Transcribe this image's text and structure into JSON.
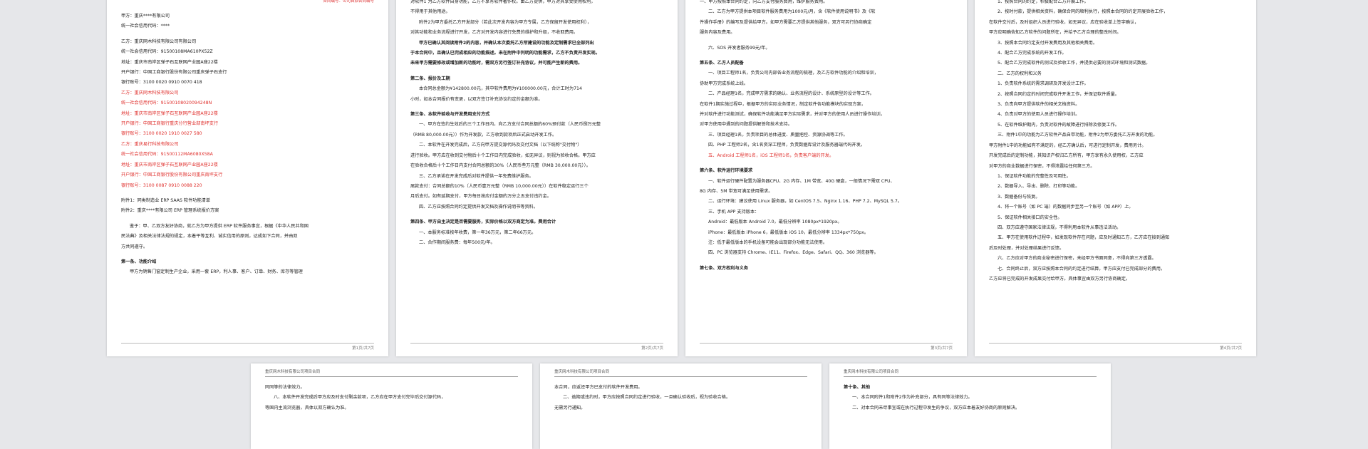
{
  "page1": {
    "top_right": "合同编号：公司自拟合同编号",
    "lines": [
      {
        "t": "甲方：重庆****有限公司",
        "c": ""
      },
      {
        "t": "统一社会信用代码：****",
        "c": ""
      },
      {
        "t": "",
        "c": "gap"
      },
      {
        "t": "乙方：重庆网木科技有限公司有限公司",
        "c": ""
      },
      {
        "t": "统一社会信用代码：91500108MA610PX52Z",
        "c": ""
      },
      {
        "t": "地址：重庆市南岸区弹子石互联网产业园A座22楼",
        "c": ""
      },
      {
        "t": "开户银行：中国工商银行股份有限公司重庆弹子石支行",
        "c": ""
      },
      {
        "t": "银行账号：3100 0020 0910 0070 418",
        "c": ""
      },
      {
        "t": "乙方：重庆网木科技有限公司",
        "c": "red"
      },
      {
        "t": "统一社会信用代码：91500108020094248N",
        "c": "red"
      },
      {
        "t": "地址：重庆市南岸区弹子石互联网产业园A座22楼",
        "c": "red"
      },
      {
        "t": "开户银行：中国工商银行重庆分行营业部南坪支行",
        "c": "red"
      },
      {
        "t": "银行账号：3100 0020 1910 0027 580",
        "c": "red"
      },
      {
        "t": "乙方：重庆易行科技有限公司",
        "c": "red"
      },
      {
        "t": "统一社会信用代码：91500112MA6080X58A",
        "c": "red"
      },
      {
        "t": "地址：重庆市南岸区弹子石互联网产业园A座22楼",
        "c": "red"
      },
      {
        "t": "开户银行：中国工商银行股份有限公司重庆南坪支行",
        "c": "red"
      },
      {
        "t": "银行账号：3100 0087 0910 0088 220",
        "c": "red"
      },
      {
        "t": "",
        "c": "gap"
      },
      {
        "t": "附件1：同类制造业 ERP SAAS 软件功能清单",
        "c": ""
      },
      {
        "t": "附件2：重庆****有限公司 ERP 管理系统报价方案",
        "c": ""
      },
      {
        "t": "",
        "c": "gap"
      },
      {
        "t": "鉴于：甲、乙双方友好协商，就乙方为甲方提供 ERP 软件服务事宜，根据《中华人民共和国",
        "c": "in"
      },
      {
        "t": "民法典》及相关法律法规的规定，本着平等互利、诚实信用的原则，达成如下合同，并由双",
        "c": ""
      },
      {
        "t": "方共同遵守。",
        "c": ""
      },
      {
        "t": "",
        "c": "gap"
      },
      {
        "t": "第一条、功能介绍",
        "c": "b"
      },
      {
        "t": "甲方为销售门窗定制生产企业，采用一套 ERP，利人事、客户、订单、财务、库存等管理",
        "c": "in"
      }
    ],
    "footer": "第1页/共7页"
  },
  "page2": {
    "lines": [
      {
        "t": "对软件1 为乙方软件自身功能，乙方不享有软件著作权。由乙方提供，甲方对其享受使用权利，",
        "c": ""
      },
      {
        "t": "不得用于其他用途。",
        "c": ""
      },
      {
        "t": "附件2为甲方委托乙方开发部分（若此次开发内容为甲方专属，乙方保留开发使用权利），",
        "c": "in"
      },
      {
        "t": "对其功能和业务流程进行开发，乙方对开发内容进行免费的维护和升级，不收取费用。",
        "c": ""
      },
      {
        "t": "甲方已确认其阅读附件2的内容，并确认本次委托乙方所建设的功能及定制需求已全部列出",
        "c": "in b"
      },
      {
        "t": "于本合同中，且确认已完成相应的功能描述。未在附件中列明的功能需求，乙方不负责开发实现。",
        "c": "b"
      },
      {
        "t": "未来甲方需要修改或增加新的功能时，需双方另行签订补充协议，并可能产生新的费用。",
        "c": "b"
      },
      {
        "t": "",
        "c": "gap"
      },
      {
        "t": "第二条、报价及工期",
        "c": "b"
      },
      {
        "t": "本合同总金额为¥142800.00元，其中软件费用为¥100000.00元，合计工时为714",
        "c": "in"
      },
      {
        "t": "小时，如本合同报价有变更，以双方签订补充协议约定的金额为准。",
        "c": ""
      },
      {
        "t": "",
        "c": "gap"
      },
      {
        "t": "第三条、本软件验收与开发费用支付方式",
        "c": "b"
      },
      {
        "t": "一、甲方在签约生效后的三个工作日内，向乙方支付合同总额的60%预付款（人民币捌万元整",
        "c": "in"
      },
      {
        "t": "（RMB 80,000.00元））作为开发款，乙方收到款项后正式启动开发工作。",
        "c": ""
      },
      {
        "t": "二、本软件在开发完成后，乙方向甲方提交源代码及交付文档（以下统称\"交付物\"）",
        "c": "in"
      },
      {
        "t": "进行验收。甲方应在收到交付物后十个工作日内完成验收，如无异议，则视为验收合格。甲方应",
        "c": ""
      },
      {
        "t": "在验收合格后十个工作日内支付合同总额的30%（人民币叁万元整（RMB 30,000.00元））。",
        "c": ""
      },
      {
        "t": "三、乙方承诺在开发完成后对软件提供一年免费维护服务。",
        "c": "in"
      },
      {
        "t": "尾款支付：合同总额的10%（人民币壹万元整（RMB 10,000.00元））在软件稳定运行三个",
        "c": ""
      },
      {
        "t": "月后支付。如有延期支付，甲方每日按应付金额的万分之五支付违约金。",
        "c": ""
      },
      {
        "t": "四、乙方应按照合同约定提供开发文档及操作说明书等资料。",
        "c": "in"
      },
      {
        "t": "",
        "c": "gap"
      },
      {
        "t": "第四条、甲方自主决定是否需要服务，实际价格以双方商定为准。费用合计",
        "c": "b"
      },
      {
        "t": "一、本服务标准按年收费，第一年36万元，第二年66万元。",
        "c": "in"
      },
      {
        "t": "二、合作期间服务费：每年500元/年。",
        "c": "in"
      }
    ],
    "footer": "第2页/共7页"
  },
  "page3": {
    "lines": [
      {
        "t": "一、甲方按照本合同约定，向乙方支付服务费用，维护服务费用。",
        "c": ""
      },
      {
        "t": "二、乙方为甲方提供本项目软件服务费用为1000元/月，含《软件使用说明书》及《软",
        "c": "in"
      },
      {
        "t": "件操作手册》的编写及提供给甲方。如甲方需要乙方提供其他服务，双方可另行协商确定",
        "c": ""
      },
      {
        "t": "服务内容及费用。",
        "c": ""
      },
      {
        "t": "",
        "c": "gap"
      },
      {
        "t": "六、SOS 开发者服务99元/年。",
        "c": "in"
      },
      {
        "t": "",
        "c": "gap"
      },
      {
        "t": "第五条、乙方人员配备",
        "c": "b"
      },
      {
        "t": "一、项目工程师1名，负责公司内部各业务流程的梳理，及乙方软件功能的介绍和培训，",
        "c": "in"
      },
      {
        "t": "协助甲方完成系统上线。",
        "c": ""
      },
      {
        "t": "二、产品经理1名，完成甲方需求的确认、业务流程的设计、系统原型的设计等工作。",
        "c": "in"
      },
      {
        "t": "在软件1期实施过程中，根据甲方的实际业务情况，制定软件各功能模块的实现方案，",
        "c": ""
      },
      {
        "t": "并对软件进行功能测试，确保软件功能满足甲方实际需求，并对甲方的使用人员进行操作培训，",
        "c": ""
      },
      {
        "t": "对甲方使用中遇到的问题提供解答和技术支持。",
        "c": ""
      },
      {
        "t": "三、项目经理1名，负责项目的总体进度、质量把控、资源协调等工作。",
        "c": "in"
      },
      {
        "t": "四、PHP 工程师2名，含1名资深工程师，负责数据库设计及服务器端代码开发。",
        "c": "in"
      },
      {
        "t": "五、Android 工程师1名，iOS 工程师1名，负责客户端的开发。",
        "c": "in red"
      },
      {
        "t": "",
        "c": "gap"
      },
      {
        "t": "第六条、软件运行环境要求",
        "c": "b"
      },
      {
        "t": "一、软件运行硬件配置为服务器CPU、2G 内存、1M 带宽、40G 硬盘，一般情况下需双 CPU、",
        "c": "in"
      },
      {
        "t": "8G 内存、5M 带宽可满足使用需求。",
        "c": ""
      },
      {
        "t": "二、运行环境：建议使用 Linux 服务器，如 CentOS 7.5、Nginx 1.16、PHP 7.2、MySQL 5.7。",
        "c": "in"
      },
      {
        "t": "三、手机 APP 支持版本：",
        "c": "in"
      },
      {
        "t": "Android：最低版本 Android 7.0，最低分辨率 1080px*1920px。",
        "c": "in"
      },
      {
        "t": "iPhone：最低版本 iPhone 6，最低版本 iOS 10，最低分辨率 1334px*750px。",
        "c": "in"
      },
      {
        "t": "注：低于最低版本的手机设备可能会出现部分功能无法使用。",
        "c": "in"
      },
      {
        "t": "四、PC 浏览器支持 Chrome、IE11、Firefox、Edge、Safari、QQ、360 浏览器等。",
        "c": "in"
      },
      {
        "t": "",
        "c": "gap"
      },
      {
        "t": "第七条、双方权利与义务",
        "c": "b"
      }
    ],
    "footer": "第3页/共7页"
  },
  "page4": {
    "lines": [
      {
        "t": "1、按照合同的约定，积极配合乙方开展工作。",
        "c": "in"
      },
      {
        "t": "2、按时付款，提供相关资料，确保合同的顺利执行，按照本合同的约定开展验收工作，",
        "c": "in"
      },
      {
        "t": "在软件交付后，及时组织人员进行验收，如无异议，应在验收单上签字确认，",
        "c": ""
      },
      {
        "t": "甲方应明确告知乙方软件的问题所在，并给予乙方合理的整改时间。",
        "c": ""
      },
      {
        "t": "3、按照本合同约定支付开发费用及其他相关费用。",
        "c": "in"
      },
      {
        "t": "4、配合乙方完成系统的开发工作。",
        "c": "in"
      },
      {
        "t": "5、配合乙方完成软件的测试及验收工作，并提供必要的测试环境和测试数据。",
        "c": "in"
      },
      {
        "t": "二、乙方的权利和义务",
        "c": "in"
      },
      {
        "t": "1、负责软件系统的需求调研及开发设计工作。",
        "c": "in"
      },
      {
        "t": "2、按照合同约定的时间完成软件开发工作，并保证软件质量。",
        "c": "in"
      },
      {
        "t": "3、负责向甲方提供软件的相关文档资料。",
        "c": "in"
      },
      {
        "t": "4、负责对甲方的使用人员进行操作培训。",
        "c": "in"
      },
      {
        "t": "5、在软件维护期内，负责对软件的故障进行排除及修复工作。",
        "c": "in"
      },
      {
        "t": "三、附件1中的功能为乙方软件产品自带功能，附件2为甲方委托乙方开发的功能。",
        "c": "in"
      },
      {
        "t": "甲方附件1中的功能如有不满足的，经乙方确认后，可进行定制开发，费用另计。",
        "c": ""
      },
      {
        "t": "开发完成后的定制功能，其知识产权归乙方所有，甲方享有永久使用权，乙方应",
        "c": ""
      },
      {
        "t": "对甲方的商业数据进行保密，不得泄露给任何第三方。",
        "c": ""
      },
      {
        "t": "1、保证软件功能的完整性及可用性。",
        "c": "in"
      },
      {
        "t": "2、数据导入、导出、删除、打印等功能。",
        "c": "in"
      },
      {
        "t": "3、数据备份与恢复。",
        "c": "in"
      },
      {
        "t": "4、将一个账号（如 PC 端）的数据同步至另一个账号（如 APP）上。",
        "c": "in"
      },
      {
        "t": "5、保证软件相关接口的安全性。",
        "c": "in"
      },
      {
        "t": "四、双方应遵守国家法律法规，不得利用本软件从事违法活动。",
        "c": "in"
      },
      {
        "t": "五、甲方在使用软件过程中，如发现软件存在问题，应及时通知乙方，乙方应在接到通知",
        "c": "in"
      },
      {
        "t": "后及时处理，并对处理结果进行反馈。",
        "c": ""
      },
      {
        "t": "六、乙方应对甲方的商业秘密进行保密，未经甲方书面同意，不得向第三方透露。",
        "c": "in"
      },
      {
        "t": "七、合同终止后，双方应按照本合同的约定进行结算，甲方应支付已完成部分的费用，",
        "c": "in"
      },
      {
        "t": "乙方应将已完成的开发成果交付给甲方。具体事宜由双方另行协商确定。",
        "c": ""
      }
    ],
    "footer": "第4页/共7页"
  },
  "page5": {
    "header": "重庆网木科技有限公司项目合同",
    "lines": [
      {
        "t": "同同等的法律效力。",
        "c": ""
      },
      {
        "t": "八、本软件开发完成后甲方应及时支付剩余款项，乙方应在甲方支付完毕后交付源代码，",
        "c": "in"
      },
      {
        "t": "等国内主流浏览器，具体以双方确认为准。",
        "c": ""
      }
    ]
  },
  "page6": {
    "header": "重庆网木科技有限公司项目合同",
    "lines": [
      {
        "t": "本合同，应返还甲方已支付的软件开发费用。",
        "c": ""
      },
      {
        "t": "二、逾期或违约时，甲方应按照合同约定进行验收，一旦确认验收后，视为验收合格。",
        "c": "in"
      },
      {
        "t": "无需另行通知。",
        "c": ""
      }
    ]
  },
  "page7": {
    "header": "重庆网木科技有限公司项目合同",
    "lines": [
      {
        "t": "第十条、其他",
        "c": "b"
      },
      {
        "t": "一、本合同附件1和附件2作为补充部分，具有同等法律效力。",
        "c": "in"
      },
      {
        "t": "二、对本合同未尽事宜或在执行过程中发生的争议，双方应本着友好协商的原则解决。",
        "c": "in"
      }
    ]
  }
}
